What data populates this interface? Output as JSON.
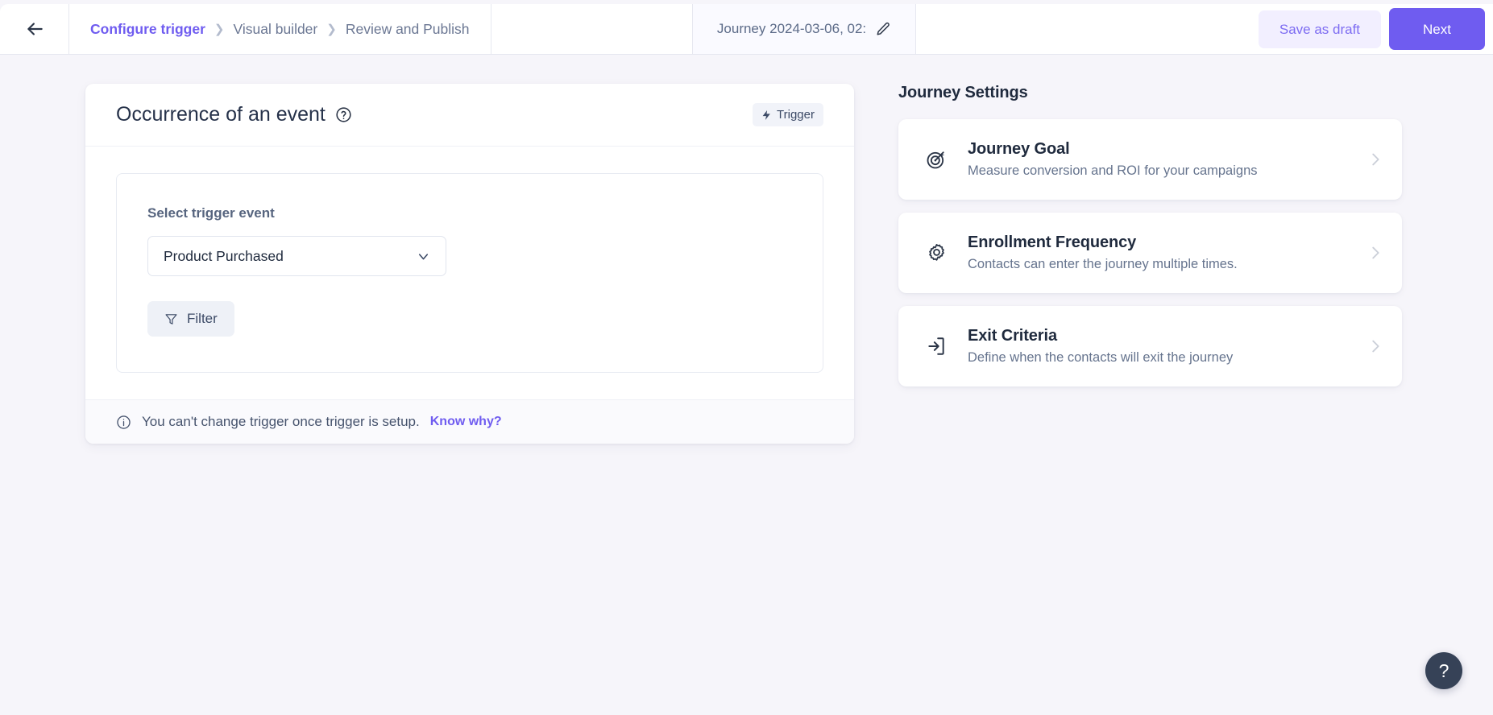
{
  "topbar": {
    "back_icon": "arrow-left-icon",
    "breadcrumb": [
      {
        "label": "Configure trigger",
        "active": true
      },
      {
        "label": "Visual builder",
        "active": false
      },
      {
        "label": "Review and Publish",
        "active": false
      }
    ],
    "separator": "›",
    "journey_name": "Journey 2024-03-06, 02:",
    "edit_icon": "pencil-icon",
    "save_draft_label": "Save as draft",
    "next_label": "Next"
  },
  "trigger_card": {
    "title": "Occurrence of an event",
    "help_icon": "question-circle-icon",
    "badge_label": "Trigger",
    "badge_icon": "lightning-bolt-icon",
    "field_label": "Select trigger event",
    "select_value": "Product Purchased",
    "select_icon": "chevron-down-icon",
    "filter_label": "Filter",
    "filter_icon": "funnel-icon",
    "footer_icon": "info-circle-icon",
    "footer_text": "You can't change trigger once trigger is setup.",
    "footer_link": "Know why?"
  },
  "settings": {
    "title": "Journey Settings",
    "items": [
      {
        "icon": "target-icon",
        "name": "Journey Goal",
        "desc": "Measure conversion and ROI for your campaigns"
      },
      {
        "icon": "gear-icon",
        "name": "Enrollment Frequency",
        "desc": "Contacts can enter the journey multiple times."
      },
      {
        "icon": "exit-arrow-icon",
        "name": "Exit Criteria",
        "desc": "Define when the contacts will exit the journey"
      }
    ],
    "chevron_icon": "chevron-right-icon"
  },
  "help_fab": {
    "label": "?",
    "icon": "question-mark-icon"
  },
  "colors": {
    "accent": "#6f5cf0",
    "accent_soft": "#f2efff",
    "page_bg": "#f6f5fa",
    "card_bg": "#ffffff",
    "text_dark": "#1f2a3d",
    "text_muted": "#66748e",
    "fab_bg": "#364257"
  }
}
